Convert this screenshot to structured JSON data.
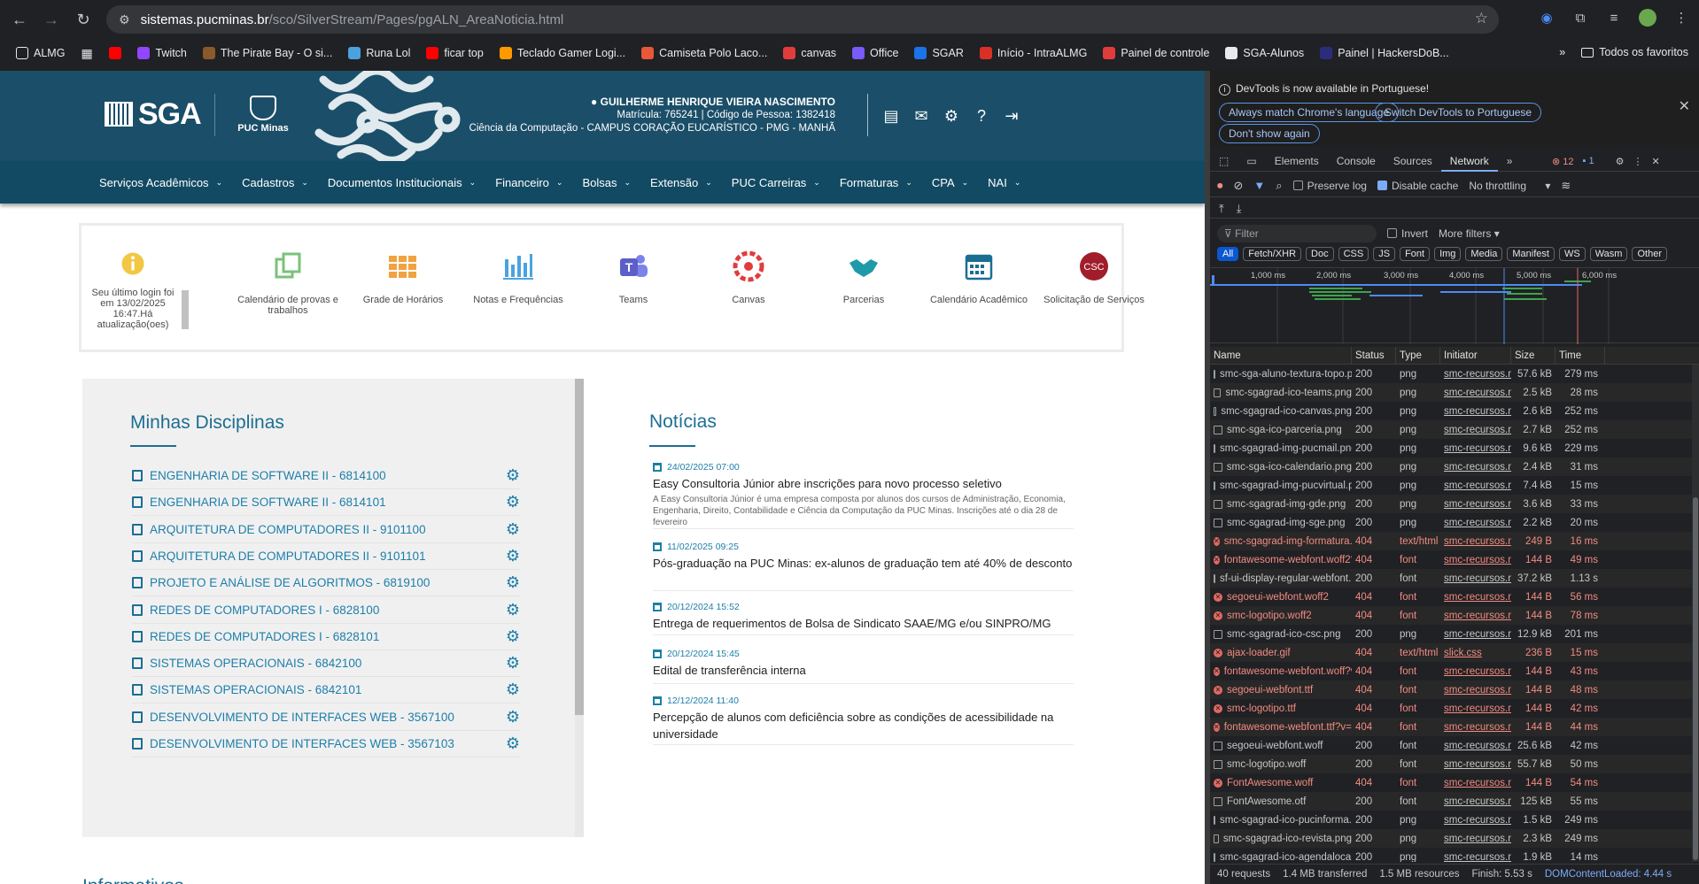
{
  "browser": {
    "url_domain": "sistemas.pucminas.br",
    "url_path": "/sco/SilverStream/Pages/pgALN_AreaNoticia.html",
    "bookmarks": [
      {
        "label": "ALMG",
        "color": "#e8eaed"
      },
      {
        "label": "",
        "color": "#e8eaed"
      },
      {
        "label": "",
        "color": "#ff0000"
      },
      {
        "label": "Twitch",
        "color": "#9146ff"
      },
      {
        "label": "The Pirate Bay - O si...",
        "color": "#8a5a2b"
      },
      {
        "label": "Runa Lol",
        "color": "#4aa3df"
      },
      {
        "label": "ficar top",
        "color": "#ff0000"
      },
      {
        "label": "Teclado Gamer Logi...",
        "color": "#ff9900"
      },
      {
        "label": "Camiseta Polo Laco...",
        "color": "#e8573a"
      },
      {
        "label": "canvas",
        "color": "#e13c3c"
      },
      {
        "label": "Office",
        "color": "#7a5af8"
      },
      {
        "label": "SGAR",
        "color": "#1a73e8"
      },
      {
        "label": "Início - IntraALMG",
        "color": "#d93025"
      },
      {
        "label": "Painel de controle",
        "color": "#e13c3c"
      },
      {
        "label": "SGA-Alunos",
        "color": "#e8eaed"
      },
      {
        "label": "Painel | HackersDoB...",
        "color": "#2b2d7c"
      }
    ],
    "bookmarks_more": "»",
    "all_bookmarks": "Todos os favoritos"
  },
  "header": {
    "logo_text": "SGA",
    "institution": "PUC Minas",
    "user_name": "GUILHERME HENRIQUE VIEIRA NASCIMENTO",
    "user_meta": "Matrícula: 765241 | Código de Pessoa: 1382418",
    "user_course": "Ciência da Computação - CAMPUS CORAÇÃO EUCARÍSTICO - PMG - MANHÃ"
  },
  "nav": [
    "Serviços Acadêmicos",
    "Cadastros",
    "Documentos Institucionais",
    "Financeiro",
    "Bolsas",
    "Extensão",
    "PUC Carreiras",
    "Formaturas",
    "CPA",
    "NAI"
  ],
  "shortcuts": {
    "login_info": "Seu último login foi em 13/02/2025 16:47.Há atualização(oes)",
    "items": [
      "Calendário de provas e trabalhos",
      "Grade de Horários",
      "Notas e Frequências",
      "Teams",
      "Canvas",
      "Parcerias",
      "Calendário Acadêmico",
      "Solicitação de Serviços"
    ],
    "colors": {
      "info": "#f2c744",
      "calendar": "#7ac27a",
      "grade": "#f0a340",
      "notas": "#4aa3df",
      "teams": "#5b5fc7",
      "canvas": "#e13c3c",
      "parcerias": "#1f9aa8",
      "academico": "#1b6e92",
      "csc": "#a11d2b"
    },
    "csc_text": "CSC"
  },
  "disciplinas": {
    "title": "Minhas Disciplinas",
    "items": [
      "ENGENHARIA DE SOFTWARE II - 6814100",
      "ENGENHARIA DE SOFTWARE II - 6814101",
      "ARQUITETURA DE COMPUTADORES II - 9101100",
      "ARQUITETURA DE COMPUTADORES II - 9101101",
      "PROJETO E ANÁLISE DE ALGORITMOS - 6819100",
      "REDES DE COMPUTADORES I - 6828100",
      "REDES DE COMPUTADORES I - 6828101",
      "SISTEMAS OPERACIONAIS - 6842100",
      "SISTEMAS OPERACIONAIS - 6842101",
      "DESENVOLVIMENTO DE INTERFACES WEB - 3567100",
      "DESENVOLVIMENTO DE INTERFACES WEB - 3567103"
    ]
  },
  "noticias": {
    "title": "Notícias",
    "items": [
      {
        "date": "24/02/2025 07:00",
        "head": "Easy Consultoria Júnior abre inscrições para novo processo seletivo",
        "desc": "A Easy Consultoria Júnior é uma empresa composta por alunos dos cursos de Administração, Economia, Engenharia, Direito, Contabilidade e Ciência da Computação da PUC Minas. Inscrições até o dia 28 de fevereiro"
      },
      {
        "date": "11/02/2025 09:25",
        "head": "Pós-graduação na PUC Minas: ex-alunos de graduação tem até 40% de desconto",
        "desc": ""
      },
      {
        "date": "20/12/2024 15:52",
        "head": "Entrega de requerimentos de Bolsa de Sindicato SAAE/MG e/ou SINPRO/MG",
        "desc": ""
      },
      {
        "date": "20/12/2024 15:45",
        "head": "Edital de transferência interna",
        "desc": ""
      },
      {
        "date": "12/12/2024 11:40",
        "head": "Percepção de alunos com deficiência sobre as condições de acessibilidade na universidade",
        "desc": ""
      }
    ]
  },
  "info_title": "Informativos",
  "devtools": {
    "banner_msg": "DevTools is now available in Portuguese!",
    "btn_match": "Always match Chrome's language",
    "btn_switch": "Switch DevTools to Portuguese",
    "btn_dont": "Don't show again",
    "tabs": [
      "Elements",
      "Console",
      "Sources",
      "Network"
    ],
    "active_tab": "Network",
    "errors": "12",
    "messages": "1",
    "preserve_log": "Preserve log",
    "disable_cache": "Disable cache",
    "throttling": "No throttling",
    "filter_placeholder": "Filter",
    "invert": "Invert",
    "more_filters": "More filters",
    "types": [
      "All",
      "Fetch/XHR",
      "Doc",
      "CSS",
      "JS",
      "Font",
      "Img",
      "Media",
      "Manifest",
      "WS",
      "Wasm",
      "Other"
    ],
    "timeline_labels": [
      "1,000 ms",
      "2,000 ms",
      "3,000 ms",
      "4,000 ms",
      "5,000 ms",
      "6,000 ms"
    ],
    "columns": [
      "Name",
      "Status",
      "Type",
      "Initiator",
      "Size",
      "Time"
    ],
    "rows": [
      {
        "name": "smc-sga-aluno-textura-topo.p...",
        "status": "200",
        "type": "png",
        "init": "smc-recursos.min...",
        "size": "57.6 kB",
        "time": "279 ms",
        "err": false
      },
      {
        "name": "smc-sgagrad-ico-teams.png",
        "status": "200",
        "type": "png",
        "init": "smc-recursos.min...",
        "size": "2.5 kB",
        "time": "28 ms",
        "err": false
      },
      {
        "name": "smc-sgagrad-ico-canvas.png",
        "status": "200",
        "type": "png",
        "init": "smc-recursos.min...",
        "size": "2.6 kB",
        "time": "252 ms",
        "err": false
      },
      {
        "name": "smc-sga-ico-parceria.png",
        "status": "200",
        "type": "png",
        "init": "smc-recursos.min...",
        "size": "2.7 kB",
        "time": "252 ms",
        "err": false
      },
      {
        "name": "smc-sgagrad-img-pucmail.png",
        "status": "200",
        "type": "png",
        "init": "smc-recursos.min...",
        "size": "9.6 kB",
        "time": "229 ms",
        "err": false
      },
      {
        "name": "smc-sga-ico-calendario.png",
        "status": "200",
        "type": "png",
        "init": "smc-recursos.min...",
        "size": "2.4 kB",
        "time": "31 ms",
        "err": false
      },
      {
        "name": "smc-sgagrad-img-pucvirtual.p...",
        "status": "200",
        "type": "png",
        "init": "smc-recursos.min...",
        "size": "7.4 kB",
        "time": "15 ms",
        "err": false
      },
      {
        "name": "smc-sgagrad-img-gde.png",
        "status": "200",
        "type": "png",
        "init": "smc-recursos.min...",
        "size": "3.6 kB",
        "time": "33 ms",
        "err": false
      },
      {
        "name": "smc-sgagrad-img-sge.png",
        "status": "200",
        "type": "png",
        "init": "smc-recursos.min...",
        "size": "2.2 kB",
        "time": "20 ms",
        "err": false
      },
      {
        "name": "smc-sgagrad-img-formatura.p...",
        "status": "404",
        "type": "text/html",
        "init": "smc-recursos.min...",
        "size": "249 B",
        "time": "16 ms",
        "err": true
      },
      {
        "name": "fontawesome-webfont.woff2?v...",
        "status": "404",
        "type": "font",
        "init": "smc-recursos.min...",
        "size": "144 B",
        "time": "49 ms",
        "err": true
      },
      {
        "name": "sf-ui-display-regular-webfont....",
        "status": "200",
        "type": "font",
        "init": "smc-recursos.min...",
        "size": "37.2 kB",
        "time": "1.13 s",
        "err": false
      },
      {
        "name": "segoeui-webfont.woff2",
        "status": "404",
        "type": "font",
        "init": "smc-recursos.min...",
        "size": "144 B",
        "time": "56 ms",
        "err": true
      },
      {
        "name": "smc-logotipo.woff2",
        "status": "404",
        "type": "font",
        "init": "smc-recursos.min...",
        "size": "144 B",
        "time": "78 ms",
        "err": true
      },
      {
        "name": "smc-sgagrad-ico-csc.png",
        "status": "200",
        "type": "png",
        "init": "smc-recursos.min...",
        "size": "12.9 kB",
        "time": "201 ms",
        "err": false
      },
      {
        "name": "ajax-loader.gif",
        "status": "404",
        "type": "text/html",
        "init": "slick.css",
        "size": "236 B",
        "time": "15 ms",
        "err": true
      },
      {
        "name": "fontawesome-webfont.woff?v...",
        "status": "404",
        "type": "font",
        "init": "smc-recursos.min...",
        "size": "144 B",
        "time": "43 ms",
        "err": true
      },
      {
        "name": "segoeui-webfont.ttf",
        "status": "404",
        "type": "font",
        "init": "smc-recursos.min...",
        "size": "144 B",
        "time": "48 ms",
        "err": true
      },
      {
        "name": "smc-logotipo.ttf",
        "status": "404",
        "type": "font",
        "init": "smc-recursos.min...",
        "size": "144 B",
        "time": "42 ms",
        "err": true
      },
      {
        "name": "fontawesome-webfont.ttf?v=4...",
        "status": "404",
        "type": "font",
        "init": "smc-recursos.min...",
        "size": "144 B",
        "time": "44 ms",
        "err": true
      },
      {
        "name": "segoeui-webfont.woff",
        "status": "200",
        "type": "font",
        "init": "smc-recursos.min...",
        "size": "25.6 kB",
        "time": "42 ms",
        "err": false
      },
      {
        "name": "smc-logotipo.woff",
        "status": "200",
        "type": "font",
        "init": "smc-recursos.min...",
        "size": "55.7 kB",
        "time": "50 ms",
        "err": false
      },
      {
        "name": "FontAwesome.woff",
        "status": "404",
        "type": "font",
        "init": "smc-recursos.min...",
        "size": "144 B",
        "time": "54 ms",
        "err": true
      },
      {
        "name": "FontAwesome.otf",
        "status": "200",
        "type": "font",
        "init": "smc-recursos.min...",
        "size": "125 kB",
        "time": "55 ms",
        "err": false
      },
      {
        "name": "smc-sgagrad-ico-pucinforma.p...",
        "status": "200",
        "type": "png",
        "init": "smc-recursos.min...",
        "size": "1.5 kB",
        "time": "249 ms",
        "err": false
      },
      {
        "name": "smc-sgagrad-ico-revista.png",
        "status": "200",
        "type": "png",
        "init": "smc-recursos.min...",
        "size": "2.3 kB",
        "time": "249 ms",
        "err": false
      },
      {
        "name": "smc-sgagrad-ico-agendalocal....",
        "status": "200",
        "type": "png",
        "init": "smc-recursos.min...",
        "size": "1.9 kB",
        "time": "14 ms",
        "err": false
      }
    ],
    "status_requests": "40 requests",
    "status_transferred": "1.4 MB transferred",
    "status_resources": "1.5 MB resources",
    "status_finish": "Finish: 5.53 s",
    "status_dom": "DOMContentLoaded: 4.44 s"
  }
}
